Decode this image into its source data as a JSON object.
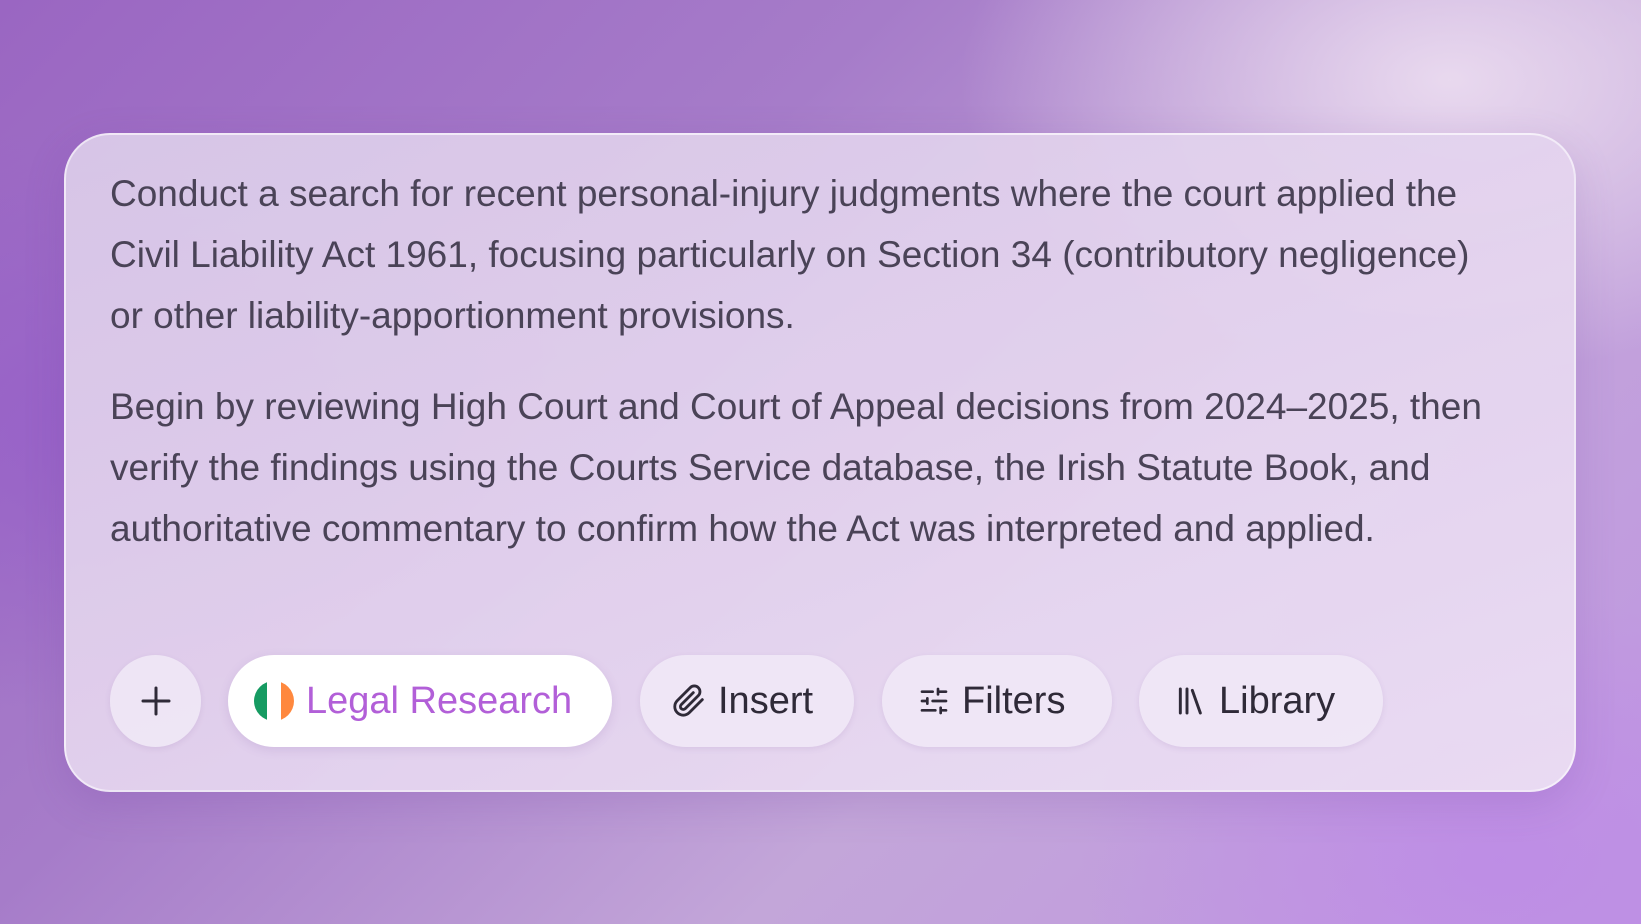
{
  "prompt": {
    "paragraphs": [
      "Conduct a search for recent personal-injury judgments where the court applied the Civil Liability Act 1961, focusing particularly on Section 34 (contributory negligence) or other liability-apportionment provisions.",
      "Begin by reviewing High Court and Court of Appeal decisions from 2024–2025, then verify the findings using the Courts Service database, the Irish Statute Book, and authoritative commentary to confirm how the Act was interpreted and applied."
    ]
  },
  "toolbar": {
    "add_icon": "plus-icon",
    "mode": {
      "label": "Legal Research",
      "icon": "ireland-flag-icon",
      "active": true
    },
    "insert": {
      "label": "Insert",
      "icon": "paperclip-icon"
    },
    "filters": {
      "label": "Filters",
      "icon": "sliders-icon"
    },
    "library": {
      "label": "Library",
      "icon": "library-books-icon"
    }
  },
  "colors": {
    "accent": "#b25fd8",
    "text": "#4a4357",
    "flag_green": "#169b62",
    "flag_white": "#ffffff",
    "flag_orange": "#ff883e"
  }
}
